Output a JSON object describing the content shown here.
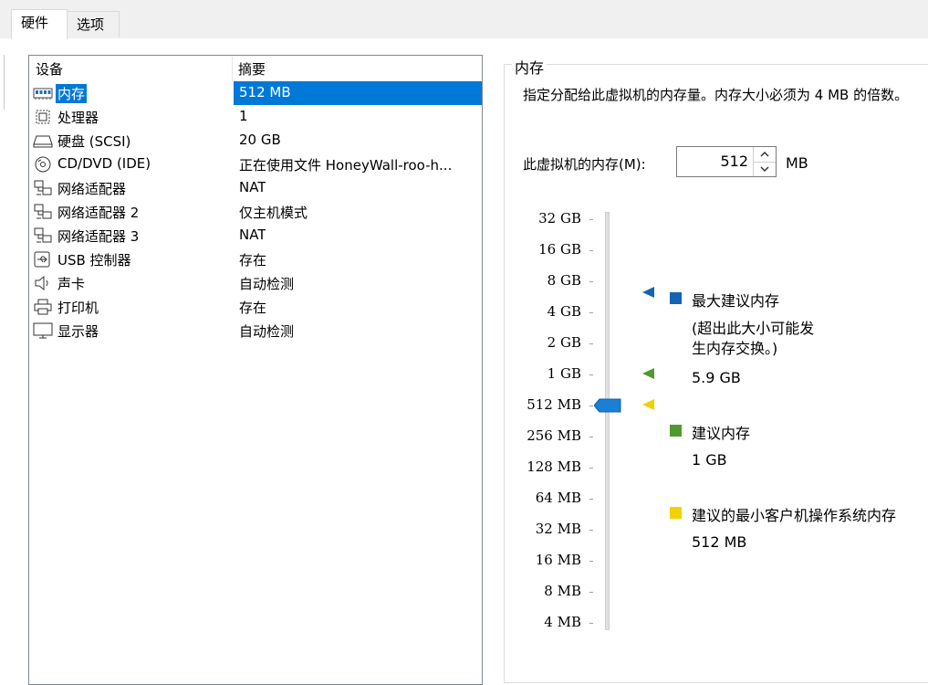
{
  "tabs": {
    "hardware": "硬件",
    "options": "选项"
  },
  "devices": {
    "col_device": "设备",
    "col_summary": "摘要",
    "rows": [
      {
        "icon": "memory-icon",
        "name": "内存",
        "summary": "512 MB",
        "selected": true
      },
      {
        "icon": "processor-icon",
        "name": "处理器",
        "summary": "1"
      },
      {
        "icon": "harddisk-icon",
        "name": "硬盘 (SCSI)",
        "summary": "20 GB"
      },
      {
        "icon": "cd-dvd-icon",
        "name": "CD/DVD (IDE)",
        "summary": "正在使用文件 HoneyWall-roo-h..."
      },
      {
        "icon": "network-adapter-icon",
        "name": "网络适配器",
        "summary": "NAT"
      },
      {
        "icon": "network-adapter-icon",
        "name": "网络适配器 2",
        "summary": "仅主机模式"
      },
      {
        "icon": "network-adapter-icon",
        "name": "网络适配器 3",
        "summary": "NAT"
      },
      {
        "icon": "usb-icon",
        "name": "USB 控制器",
        "summary": "存在"
      },
      {
        "icon": "speaker-icon",
        "name": "声卡",
        "summary": "自动检测"
      },
      {
        "icon": "printer-icon",
        "name": "打印机",
        "summary": "存在"
      },
      {
        "icon": "monitor-icon",
        "name": "显示器",
        "summary": "自动检测"
      }
    ]
  },
  "memory": {
    "group_title": "内存",
    "description": "指定分配给此虚拟机的内存量。内存大小必须为 4 MB 的倍数。",
    "label": "此虚拟机的内存(M):",
    "value": "512",
    "unit": "MB",
    "scale": [
      "32 GB",
      "16 GB",
      "8 GB",
      "4 GB",
      "2 GB",
      "1 GB",
      "512 MB",
      "256 MB",
      "128 MB",
      "64 MB",
      "32 MB",
      "16 MB",
      "8 MB",
      "4 MB"
    ],
    "slider_value": "512 MB",
    "legend": {
      "max_title": "最大建议内存",
      "max_note": "(超出此大小可能发生内存交换。)",
      "max_value": "5.9 GB",
      "rec_title": "建议内存",
      "rec_value": "1 GB",
      "min_title": "建议的最小客户机操作系统内存",
      "min_value": "512 MB"
    },
    "colors": {
      "max": "#1464b4",
      "recommended": "#4f9a2e",
      "minimum": "#f2d100",
      "slider": "#1a7fd6",
      "selection": "#0078d7"
    }
  }
}
